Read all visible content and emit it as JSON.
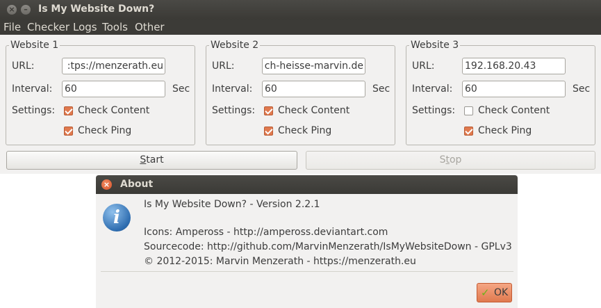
{
  "window": {
    "title": "Is My Website Down?",
    "close_glyph": "×",
    "minimize_glyph": "–"
  },
  "menu": [
    "File",
    "Checker",
    "Logs",
    "Tools",
    "Other"
  ],
  "websites": [
    {
      "legend": "Website 1",
      "url_label": "URL:",
      "url_visible": ":tps://menzerath.eu",
      "interval_label": "Interval:",
      "interval": "60",
      "unit": "Sec",
      "settings_label": "Settings:",
      "check_content_label": "Check Content",
      "check_content": true,
      "check_ping_label": "Check Ping",
      "check_ping": true
    },
    {
      "legend": "Website 2",
      "url_label": "URL:",
      "url_visible": "ch-heisse-marvin.de",
      "interval_label": "Interval:",
      "interval": "60",
      "unit": "Sec",
      "settings_label": "Settings:",
      "check_content_label": "Check Content",
      "check_content": true,
      "check_ping_label": "Check Ping",
      "check_ping": true
    },
    {
      "legend": "Website 3",
      "url_label": "URL:",
      "url_visible": "192.168.20.43",
      "interval_label": "Interval:",
      "interval": "60",
      "unit": "Sec",
      "settings_label": "Settings:",
      "check_content_label": "Check Content",
      "check_content": false,
      "check_ping_label": "Check Ping",
      "check_ping": true
    }
  ],
  "buttons": {
    "start_mnemonic": "S",
    "start_rest": "tart",
    "stop_pre": "S",
    "stop_mnemonic": "t",
    "stop_rest": "op",
    "stop_enabled": false
  },
  "about": {
    "title": "About",
    "close_glyph": "×",
    "icon_glyph": "i",
    "version": "Is My Website Down? - Version 2.2.1",
    "icons_credit": "Icons: Ampeross - http://ampeross.deviantart.com",
    "sourcecode": "Sourcecode: http://github.com/MarvinMenzerath/IsMyWebsiteDown - GPLv3",
    "copyright": "© 2012-2015: Marvin Menzerath - https://menzerath.eu",
    "ok_label": "OK",
    "ok_glyph": "✓"
  },
  "colors": {
    "titlebar": "#3c3b37",
    "accent": "#e07a4f",
    "info_icon": "#2e6db0"
  }
}
